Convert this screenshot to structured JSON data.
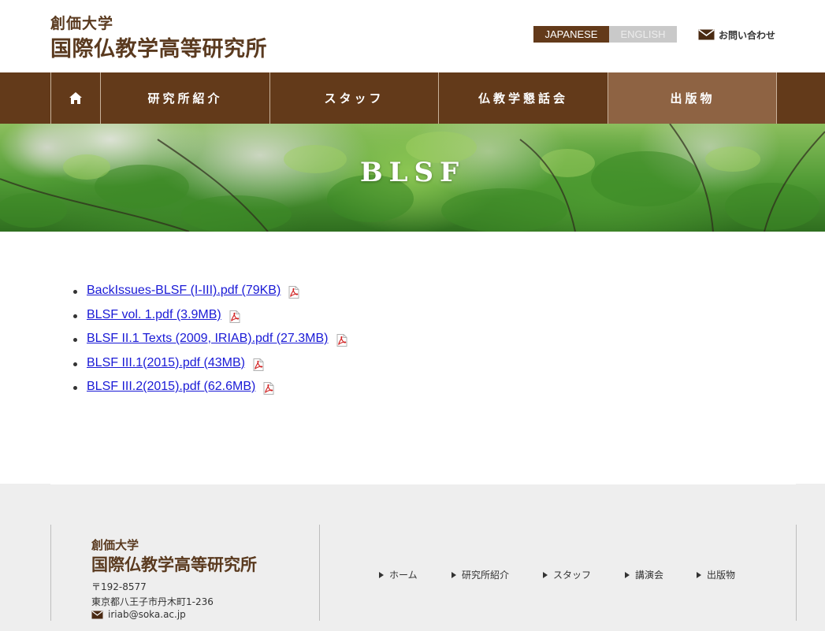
{
  "header": {
    "logo_small": "創価大学",
    "logo_large": "国際仏教学高等研究所",
    "lang_japanese": "JAPANESE",
    "lang_english": "ENGLISH",
    "contact_label": "お問い合わせ"
  },
  "nav": {
    "home_icon": "home-icon",
    "items": [
      {
        "label": "研究所紹介"
      },
      {
        "label": "スタッフ"
      },
      {
        "label": "仏教学懇話会"
      },
      {
        "label": "出版物",
        "active": true
      }
    ]
  },
  "hero": {
    "title": "BLSF"
  },
  "files": [
    {
      "label": "BackIssues-BLSF (I-III).pdf (79KB)",
      "icon": "pdf-icon"
    },
    {
      "label": "BLSF vol. 1.pdf (3.9MB)",
      "icon": "pdf-icon"
    },
    {
      "label": "BLSF II.1 Texts (2009, IRIAB).pdf (27.3MB)",
      "icon": "pdf-icon"
    },
    {
      "label": "BLSF III.1(2015).pdf (43MB)",
      "icon": "pdf-icon"
    },
    {
      "label": "BLSF III.2(2015).pdf (62.6MB)",
      "icon": "pdf-icon"
    }
  ],
  "footer": {
    "logo_small": "創価大学",
    "logo_large": "国際仏教学高等研究所",
    "postal": "〒192-8577",
    "address": "東京都八王子市丹木町1-236",
    "email": "iriab@soka.ac.jp",
    "nav": [
      {
        "label": "ホーム"
      },
      {
        "label": "研究所紹介"
      },
      {
        "label": "スタッフ"
      },
      {
        "label": "講演会"
      },
      {
        "label": "出版物"
      }
    ]
  },
  "colors": {
    "brand_brown": "#633a1a",
    "nav_active": "#8e6343",
    "link_blue": "#1a1ad6",
    "footer_bg": "#eeeeee"
  }
}
